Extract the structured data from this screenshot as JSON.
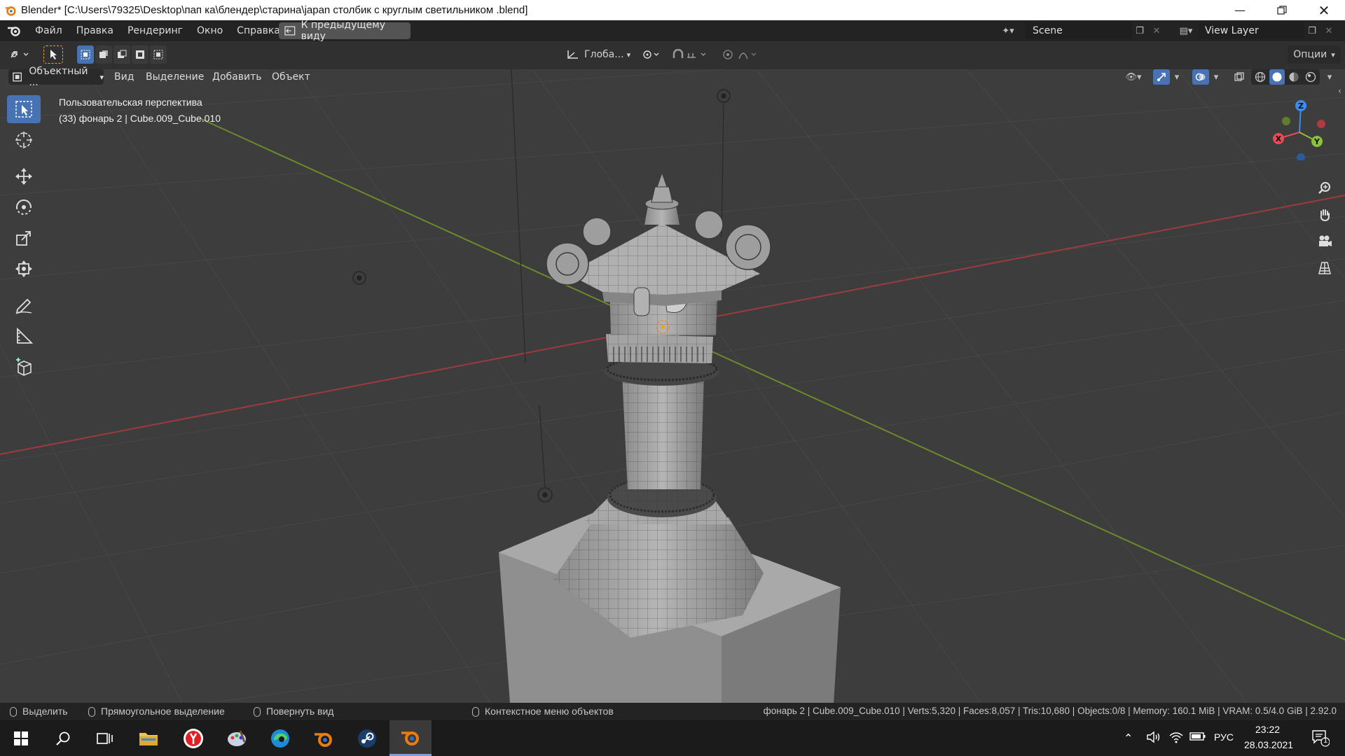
{
  "titlebar": {
    "title": "Blender* [C:\\Users\\79325\\Desktop\\пап ка\\блендер\\старина\\japan столбик с круглым светильником .blend]"
  },
  "menubar": {
    "items": [
      "Файл",
      "Правка",
      "Рендеринг",
      "Окно",
      "Справка"
    ],
    "prev_view": "К предыдущему виду",
    "scene": "Scene",
    "view_layer": "View Layer"
  },
  "toolheader": {
    "transform_orientation": "Глоба...",
    "options": "Опции"
  },
  "viewheader": {
    "mode": "Объектный ...",
    "menus": [
      "Вид",
      "Выделение",
      "Добавить",
      "Объект"
    ]
  },
  "viewport": {
    "view_name": "Пользовательская перспектива",
    "object_info": "(33) фонарь 2 | Cube.009_Cube.010",
    "gizmo": {
      "x": "X",
      "y": "Y",
      "z": "Z"
    }
  },
  "statusbar": {
    "select": "Выделить",
    "box_select": "Прямоугольное выделение",
    "rotate_view": "Повернуть вид",
    "context_menu": "Контекстное меню объектов",
    "stats": "фонарь 2 | Cube.009_Cube.010 | Verts:5,320 | Faces:8,057 | Tris:10,680 | Objects:0/8 | Memory: 160.1 MiB | VRAM: 0.5/4.0 GiB | 2.92.0"
  },
  "taskbar": {
    "language": "РУС",
    "time": "23:22",
    "date": "28.03.2021",
    "notifications": "1"
  },
  "colors": {
    "accent": "#4772b3",
    "x_axis": "#e94b56",
    "y_axis": "#8ac23a",
    "z_axis": "#3a8cf0"
  }
}
